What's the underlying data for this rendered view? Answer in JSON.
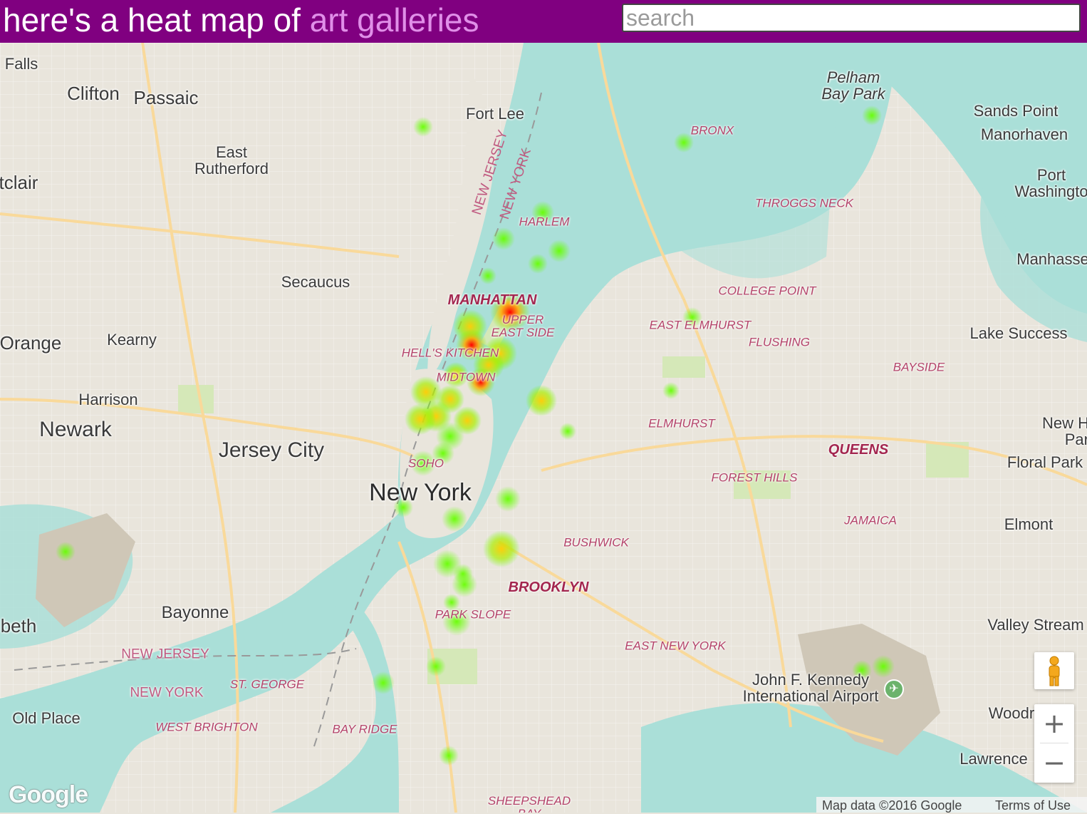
{
  "header": {
    "title_prefix": "here's a heat map of ",
    "title_highlight": "art galleries",
    "background": "#800080",
    "highlight_color": "#e08fe8"
  },
  "search": {
    "placeholder": "search",
    "value": ""
  },
  "map": {
    "labels": {
      "falls": "Falls",
      "clifton": "Clifton",
      "passaic": "Passaic",
      "fort_lee": "Fort Lee",
      "east_rutherford": "East\nRutherford",
      "montclair": "tclair",
      "secaucus": "Secaucus",
      "orange": "Orange",
      "kearny": "Kearny",
      "harrison": "Harrison",
      "newark": "Newark",
      "jersey_city": "Jersey City",
      "new_york": "New York",
      "bayonne": "Bayonne",
      "elizabeth": "beth",
      "old_place": "Old Place",
      "west_brighton": "WEST BRIGHTON",
      "st_george": "ST. GEORGE",
      "new_jersey_state": "NEW JERSEY",
      "new_york_state": "NEW YORK",
      "nj_border": "NEW JERSEY",
      "ny_border": "NEW YORK",
      "pelham_bay_park": "Pelham\nBay Park",
      "sands_point": "Sands Point",
      "manorhaven": "Manorhaven",
      "port_washington": "Port\nWashingto",
      "manhasset": "Manhasse",
      "bronx": "BRONX",
      "throggs_neck": "THROGGS NECK",
      "harlem": "HARLEM",
      "manhattan": "MANHATTAN",
      "upper_east_side": "UPPER\nEAST SIDE",
      "hells_kitchen": "HELL'S KITCHEN",
      "midtown": "MIDTOWN",
      "soho": "SOHO",
      "college_point": "COLLEGE POINT",
      "east_elmhurst": "EAST ELMHURST",
      "flushing": "FLUSHING",
      "lake_success": "Lake Success",
      "bayside": "BAYSIDE",
      "elmhurst": "ELMHURST",
      "queens": "QUEENS",
      "forest_hills": "FOREST HILLS",
      "new_hyde_park": "New H\nPar",
      "floral_park": "Floral Park",
      "jamaica": "JAMAICA",
      "elmont": "Elmont",
      "bushwick": "BUSHWICK",
      "brooklyn": "BROOKLYN",
      "park_slope": "PARK SLOPE",
      "east_new_york": "EAST NEW YORK",
      "valley_stream": "Valley Stream",
      "jfk": "John F. Kennedy\nInternational Airport",
      "woodmere": "Woodr",
      "lawrence": "Lawrence",
      "bay_ridge": "BAY RIDGE",
      "sheepshead_bay": "SHEEPSHEAD\nBAY"
    },
    "heat_colors": {
      "low": "#66ff00",
      "mid": "#ffcc00",
      "high": "#ff0000"
    },
    "water_color": "#aadfd8",
    "land_color": "#e9e5dc"
  },
  "controls": {
    "zoom_in": "+",
    "zoom_out": "−",
    "pegman_icon": "pegman-icon"
  },
  "footer": {
    "google_logo": "Google",
    "map_data": "Map data ©2016 Google",
    "terms": "Terms of Use"
  }
}
